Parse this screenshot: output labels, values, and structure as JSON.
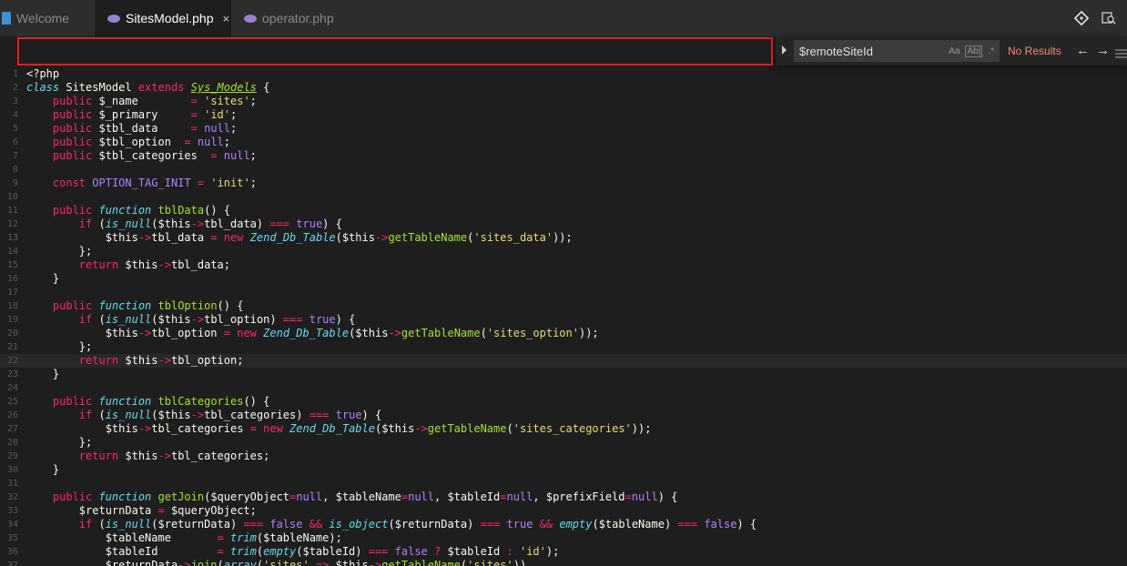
{
  "tabs": [
    {
      "label": "Welcome",
      "icon": "vscode-icon",
      "active": false
    },
    {
      "label": "SitesModel.php",
      "icon": "php-icon",
      "active": true,
      "close": "×"
    },
    {
      "label": "operator.php",
      "icon": "php-icon",
      "active": false
    }
  ],
  "find": {
    "query": "$remoteSiteId",
    "match_case": "Aa",
    "whole_word": "Ab|",
    "regex": ".*",
    "status": "No Results",
    "prev": "←",
    "next": "→"
  },
  "colors": {
    "keyword": "#f92672",
    "string": "#e6db74",
    "function": "#a6e22e",
    "storage": "#66d9ef",
    "constant": "#ae81ff",
    "highlight": "#e02020",
    "no_results": "#f48771"
  },
  "editor": {
    "current_line": 22,
    "lines": [
      {
        "n": "1",
        "t": [
          [
            "<?php",
            ""
          ]
        ]
      },
      {
        "n": "2",
        "t": [
          [
            "class",
            "sf"
          ],
          [
            " SitesModel ",
            ""
          ],
          [
            "extends",
            "kw"
          ],
          [
            " ",
            ""
          ],
          [
            "Sys_Models",
            "cl"
          ],
          [
            " {",
            ""
          ]
        ]
      },
      {
        "n": "3",
        "t": [
          [
            "    public",
            "kw"
          ],
          [
            " $_name        ",
            ""
          ],
          [
            "=",
            "kw"
          ],
          [
            " ",
            ""
          ],
          [
            "'sites'",
            "st"
          ],
          [
            ";",
            ""
          ]
        ]
      },
      {
        "n": "4",
        "t": [
          [
            "    public",
            "kw"
          ],
          [
            " $_primary     ",
            ""
          ],
          [
            "=",
            "kw"
          ],
          [
            " ",
            ""
          ],
          [
            "'id'",
            "st"
          ],
          [
            ";",
            ""
          ]
        ]
      },
      {
        "n": "5",
        "t": [
          [
            "    public",
            "kw"
          ],
          [
            " $tbl_data     ",
            ""
          ],
          [
            "=",
            "kw"
          ],
          [
            " ",
            ""
          ],
          [
            "null",
            "cn"
          ],
          [
            ";",
            ""
          ]
        ]
      },
      {
        "n": "6",
        "t": [
          [
            "    public",
            "kw"
          ],
          [
            " $tbl_option  ",
            ""
          ],
          [
            "=",
            "kw"
          ],
          [
            " ",
            ""
          ],
          [
            "null",
            "cn"
          ],
          [
            ";",
            ""
          ]
        ]
      },
      {
        "n": "7",
        "t": [
          [
            "    public",
            "kw"
          ],
          [
            " $tbl_categories  ",
            ""
          ],
          [
            "=",
            "kw"
          ],
          [
            " ",
            ""
          ],
          [
            "null",
            "cn"
          ],
          [
            ";",
            ""
          ]
        ]
      },
      {
        "n": "8",
        "t": []
      },
      {
        "n": "9",
        "t": [
          [
            "    const",
            "kw"
          ],
          [
            " ",
            ""
          ],
          [
            "OPTION_TAG_INIT",
            "cn"
          ],
          [
            " ",
            ""
          ],
          [
            "=",
            "kw"
          ],
          [
            " ",
            ""
          ],
          [
            "'init'",
            "st"
          ],
          [
            ";",
            ""
          ]
        ]
      },
      {
        "n": "10",
        "t": []
      },
      {
        "n": "11",
        "t": [
          [
            "    public",
            "kw"
          ],
          [
            " ",
            ""
          ],
          [
            "function",
            "sf"
          ],
          [
            " ",
            ""
          ],
          [
            "tblData",
            "fn"
          ],
          [
            "() {",
            ""
          ]
        ]
      },
      {
        "n": "12",
        "t": [
          [
            "        if",
            "kw"
          ],
          [
            " (",
            ""
          ],
          [
            "is_null",
            "sf"
          ],
          [
            "($this",
            ""
          ],
          [
            "->",
            "kw"
          ],
          [
            "tbl_data) ",
            ""
          ],
          [
            "===",
            "kw"
          ],
          [
            " ",
            ""
          ],
          [
            "true",
            "cn"
          ],
          [
            ") {",
            ""
          ]
        ]
      },
      {
        "n": "13",
        "t": [
          [
            "            $this",
            ""
          ],
          [
            "->",
            "kw"
          ],
          [
            "tbl_data ",
            ""
          ],
          [
            "=",
            "kw"
          ],
          [
            " ",
            ""
          ],
          [
            "new",
            "kw"
          ],
          [
            " ",
            ""
          ],
          [
            "Zend_Db_Table",
            "sf"
          ],
          [
            "($this",
            ""
          ],
          [
            "->",
            "kw"
          ],
          [
            "getTableName",
            "mc"
          ],
          [
            "(",
            ""
          ],
          [
            "'sites_data'",
            "st"
          ],
          [
            "));",
            ""
          ]
        ]
      },
      {
        "n": "14",
        "t": [
          [
            "        };",
            ""
          ]
        ]
      },
      {
        "n": "15",
        "t": [
          [
            "        return",
            "kw"
          ],
          [
            " $this",
            ""
          ],
          [
            "->",
            "kw"
          ],
          [
            "tbl_data;",
            ""
          ]
        ]
      },
      {
        "n": "16",
        "t": [
          [
            "    }",
            ""
          ]
        ]
      },
      {
        "n": "17",
        "t": []
      },
      {
        "n": "18",
        "t": [
          [
            "    public",
            "kw"
          ],
          [
            " ",
            ""
          ],
          [
            "function",
            "sf"
          ],
          [
            " ",
            ""
          ],
          [
            "tblOption",
            "fn"
          ],
          [
            "() {",
            ""
          ]
        ]
      },
      {
        "n": "19",
        "t": [
          [
            "        if",
            "kw"
          ],
          [
            " (",
            ""
          ],
          [
            "is_null",
            "sf"
          ],
          [
            "($this",
            ""
          ],
          [
            "->",
            "kw"
          ],
          [
            "tbl_option) ",
            ""
          ],
          [
            "===",
            "kw"
          ],
          [
            " ",
            ""
          ],
          [
            "true",
            "cn"
          ],
          [
            ") {",
            ""
          ]
        ]
      },
      {
        "n": "20",
        "t": [
          [
            "            $this",
            ""
          ],
          [
            "->",
            "kw"
          ],
          [
            "tbl_option ",
            ""
          ],
          [
            "=",
            "kw"
          ],
          [
            " ",
            ""
          ],
          [
            "new",
            "kw"
          ],
          [
            " ",
            ""
          ],
          [
            "Zend_Db_Table",
            "sf"
          ],
          [
            "($this",
            ""
          ],
          [
            "->",
            "kw"
          ],
          [
            "getTableName",
            "mc"
          ],
          [
            "(",
            ""
          ],
          [
            "'sites_option'",
            "st"
          ],
          [
            "));",
            ""
          ]
        ]
      },
      {
        "n": "21",
        "t": [
          [
            "        };",
            ""
          ]
        ]
      },
      {
        "n": "22",
        "t": [
          [
            "        return",
            "kw"
          ],
          [
            " $this",
            ""
          ],
          [
            "->",
            "kw"
          ],
          [
            "tbl_option;",
            ""
          ]
        ]
      },
      {
        "n": "23",
        "t": [
          [
            "    }",
            ""
          ]
        ]
      },
      {
        "n": "24",
        "t": []
      },
      {
        "n": "25",
        "t": [
          [
            "    public",
            "kw"
          ],
          [
            " ",
            ""
          ],
          [
            "function",
            "sf"
          ],
          [
            " ",
            ""
          ],
          [
            "tblCategories",
            "fn"
          ],
          [
            "() {",
            ""
          ]
        ]
      },
      {
        "n": "26",
        "t": [
          [
            "        if",
            "kw"
          ],
          [
            " (",
            ""
          ],
          [
            "is_null",
            "sf"
          ],
          [
            "($this",
            ""
          ],
          [
            "->",
            "kw"
          ],
          [
            "tbl_categories) ",
            ""
          ],
          [
            "===",
            "kw"
          ],
          [
            " ",
            ""
          ],
          [
            "true",
            "cn"
          ],
          [
            ") {",
            ""
          ]
        ]
      },
      {
        "n": "27",
        "t": [
          [
            "            $this",
            ""
          ],
          [
            "->",
            "kw"
          ],
          [
            "tbl_categories ",
            ""
          ],
          [
            "=",
            "kw"
          ],
          [
            " ",
            ""
          ],
          [
            "new",
            "kw"
          ],
          [
            " ",
            ""
          ],
          [
            "Zend_Db_Table",
            "sf"
          ],
          [
            "($this",
            ""
          ],
          [
            "->",
            "kw"
          ],
          [
            "getTableName",
            "mc"
          ],
          [
            "(",
            ""
          ],
          [
            "'sites_categories'",
            "st"
          ],
          [
            "));",
            ""
          ]
        ]
      },
      {
        "n": "28",
        "t": [
          [
            "        };",
            ""
          ]
        ]
      },
      {
        "n": "29",
        "t": [
          [
            "        return",
            "kw"
          ],
          [
            " $this",
            ""
          ],
          [
            "->",
            "kw"
          ],
          [
            "tbl_categories;",
            ""
          ]
        ]
      },
      {
        "n": "30",
        "t": [
          [
            "    }",
            ""
          ]
        ]
      },
      {
        "n": "31",
        "t": []
      },
      {
        "n": "32",
        "t": [
          [
            "    public",
            "kw"
          ],
          [
            " ",
            ""
          ],
          [
            "function",
            "sf"
          ],
          [
            " ",
            ""
          ],
          [
            "getJoin",
            "fn"
          ],
          [
            "($queryObject",
            ""
          ],
          [
            "=",
            "kw"
          ],
          [
            "null",
            "cn"
          ],
          [
            ", $tableName",
            ""
          ],
          [
            "=",
            "kw"
          ],
          [
            "null",
            "cn"
          ],
          [
            ", $tableId",
            ""
          ],
          [
            "=",
            "kw"
          ],
          [
            "null",
            "cn"
          ],
          [
            ", $prefixField",
            ""
          ],
          [
            "=",
            "kw"
          ],
          [
            "null",
            "cn"
          ],
          [
            ") {",
            ""
          ]
        ]
      },
      {
        "n": "33",
        "t": [
          [
            "        $returnData ",
            ""
          ],
          [
            "=",
            "kw"
          ],
          [
            " $queryObject;",
            ""
          ]
        ]
      },
      {
        "n": "34",
        "t": [
          [
            "        if",
            "kw"
          ],
          [
            " (",
            ""
          ],
          [
            "is_null",
            "sf"
          ],
          [
            "($returnData) ",
            ""
          ],
          [
            "===",
            "kw"
          ],
          [
            " ",
            ""
          ],
          [
            "false",
            "cn"
          ],
          [
            " ",
            ""
          ],
          [
            "&&",
            "kw"
          ],
          [
            " ",
            ""
          ],
          [
            "is_object",
            "sf"
          ],
          [
            "($returnData) ",
            ""
          ],
          [
            "===",
            "kw"
          ],
          [
            " ",
            ""
          ],
          [
            "true",
            "cn"
          ],
          [
            " ",
            ""
          ],
          [
            "&&",
            "kw"
          ],
          [
            " ",
            ""
          ],
          [
            "empty",
            "sf"
          ],
          [
            "($tableName) ",
            ""
          ],
          [
            "===",
            "kw"
          ],
          [
            " ",
            ""
          ],
          [
            "false",
            "cn"
          ],
          [
            ") {",
            ""
          ]
        ]
      },
      {
        "n": "35",
        "t": [
          [
            "            $tableName       ",
            ""
          ],
          [
            "=",
            "kw"
          ],
          [
            " ",
            ""
          ],
          [
            "trim",
            "sf"
          ],
          [
            "($tableName);",
            ""
          ]
        ]
      },
      {
        "n": "36",
        "t": [
          [
            "            $tableId         ",
            ""
          ],
          [
            "=",
            "kw"
          ],
          [
            " ",
            ""
          ],
          [
            "trim",
            "sf"
          ],
          [
            "(",
            ""
          ],
          [
            "empty",
            "sf"
          ],
          [
            "($tableId) ",
            ""
          ],
          [
            "===",
            "kw"
          ],
          [
            " ",
            ""
          ],
          [
            "false",
            "cn"
          ],
          [
            " ",
            ""
          ],
          [
            "?",
            "kw"
          ],
          [
            " $tableId ",
            ""
          ],
          [
            ":",
            "kw"
          ],
          [
            " ",
            ""
          ],
          [
            "'id'",
            "st"
          ],
          [
            ");",
            ""
          ]
        ]
      },
      {
        "n": "37",
        "t": [
          [
            "            $returnData",
            ""
          ],
          [
            "->",
            "kw"
          ],
          [
            "join",
            "mc"
          ],
          [
            "(",
            ""
          ],
          [
            "array",
            "sf"
          ],
          [
            "(",
            ""
          ],
          [
            "'sites'",
            "st"
          ],
          [
            " ",
            ""
          ],
          [
            "=>",
            "kw"
          ],
          [
            " $this",
            ""
          ],
          [
            "->",
            "kw"
          ],
          [
            "getTableName",
            "mc"
          ],
          [
            "(",
            ""
          ],
          [
            "'sites'",
            "st"
          ],
          [
            "))",
            ""
          ]
        ]
      }
    ]
  }
}
